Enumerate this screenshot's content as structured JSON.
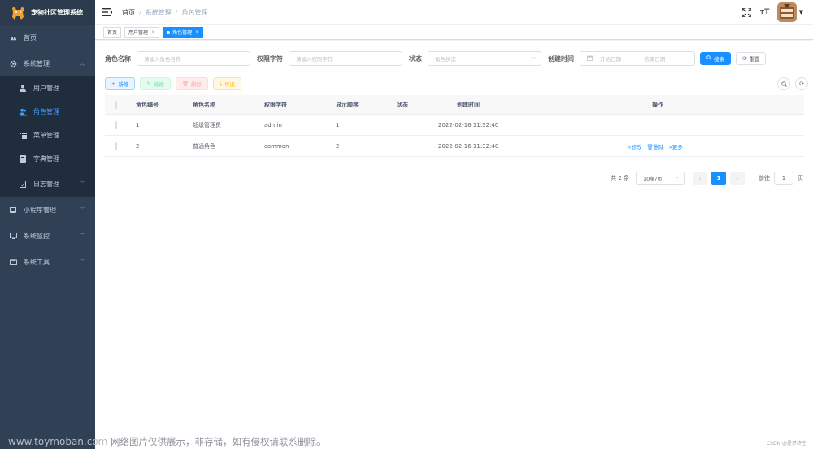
{
  "app": {
    "title": "宠物社区管理系统"
  },
  "sidebar": {
    "items": [
      {
        "label": "首页",
        "icon": "dashboard-icon"
      },
      {
        "label": "系统管理",
        "icon": "gear-icon",
        "expanded": true,
        "children": [
          {
            "label": "用户管理",
            "icon": "user-icon"
          },
          {
            "label": "角色管理",
            "icon": "peoples-icon",
            "active": true
          },
          {
            "label": "菜单管理",
            "icon": "tree-table-icon"
          },
          {
            "label": "字典管理",
            "icon": "dict-icon"
          },
          {
            "label": "日志管理",
            "icon": "log-icon"
          }
        ]
      },
      {
        "label": "小程序管理",
        "icon": "app-icon"
      },
      {
        "label": "系统监控",
        "icon": "monitor-icon"
      },
      {
        "label": "系统工具",
        "icon": "tool-icon"
      }
    ]
  },
  "navbar": {
    "breadcrumb": [
      "首页",
      "系统管理",
      "角色管理"
    ],
    "separator": "/",
    "size_icon_text": "тT"
  },
  "tags": [
    {
      "label": "首页",
      "closable": false
    },
    {
      "label": "用户管理",
      "closable": true
    },
    {
      "label": "角色管理",
      "closable": true,
      "active": true
    }
  ],
  "search_form": {
    "role_name_label": "角色名称",
    "role_name_placeholder": "请输入角色名称",
    "role_key_label": "权限字符",
    "role_key_placeholder": "请输入权限字符",
    "status_label": "状态",
    "status_placeholder": "角色状态",
    "create_time_label": "创建时间",
    "start_placeholder": "开始日期",
    "range_sep": "-",
    "end_placeholder": "结束日期",
    "search_button": "搜索",
    "reset_button": "重置"
  },
  "toolbar": {
    "add": "新增",
    "edit": "修改",
    "delete": "删除",
    "export": "导出"
  },
  "table": {
    "columns": [
      "角色编号",
      "角色名称",
      "权限字符",
      "显示顺序",
      "状态",
      "创建时间",
      "操作"
    ],
    "rows": [
      {
        "id": "1",
        "name": "超级管理员",
        "key": "admin",
        "sort": "1",
        "enabled": true,
        "created": "2022-02-16 11:32:40",
        "ops": []
      },
      {
        "id": "2",
        "name": "普通角色",
        "key": "common",
        "sort": "2",
        "enabled": true,
        "created": "2022-02-16 11:32:40",
        "ops": [
          "修改",
          "删除",
          "更多"
        ]
      }
    ]
  },
  "pagination": {
    "total_text": "共 2 条",
    "page_size": "10条/页",
    "current_page": "1",
    "goto_label": "前往",
    "goto_value": "1",
    "page_suffix": "页"
  },
  "watermark": {
    "site": "www.toymoban.com",
    "notice": " 网络图片仅供展示，非存储，如有侵权请联系删除。",
    "credit": "CSDN @是梦终空"
  },
  "colors": {
    "sidebar_bg": "#304156",
    "primary": "#1890ff",
    "active_menu": "#409eff"
  }
}
